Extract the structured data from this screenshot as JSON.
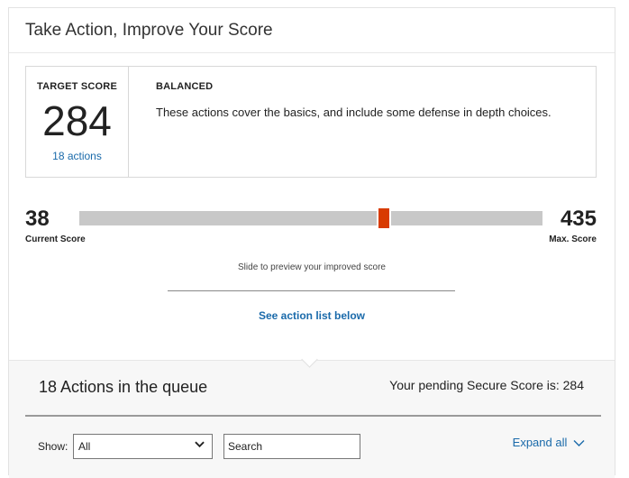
{
  "page": {
    "title": "Take Action, Improve Your Score"
  },
  "target": {
    "label": "TARGET SCORE",
    "value": "284",
    "actions_link": "18 actions",
    "plan_name": "BALANCED",
    "plan_description": "These actions cover the basics, and include some defense in depth choices."
  },
  "slider": {
    "current_score": "38",
    "current_label": "Current Score",
    "max_score": "435",
    "max_label": "Max. Score",
    "target_value": 284,
    "min_value": 38,
    "max_value": 435,
    "accent_color": "#d83b01",
    "hint": "Slide to preview your improved score",
    "see_list_link": "See action list below"
  },
  "queue": {
    "title": "18 Actions in the queue",
    "pending_text": "Your pending Secure Score is: 284",
    "show_label": "Show:",
    "show_selected": "All",
    "search_placeholder": "Search",
    "expand_all_label": "Expand all",
    "expand_icon": "chevron-down-icon"
  }
}
